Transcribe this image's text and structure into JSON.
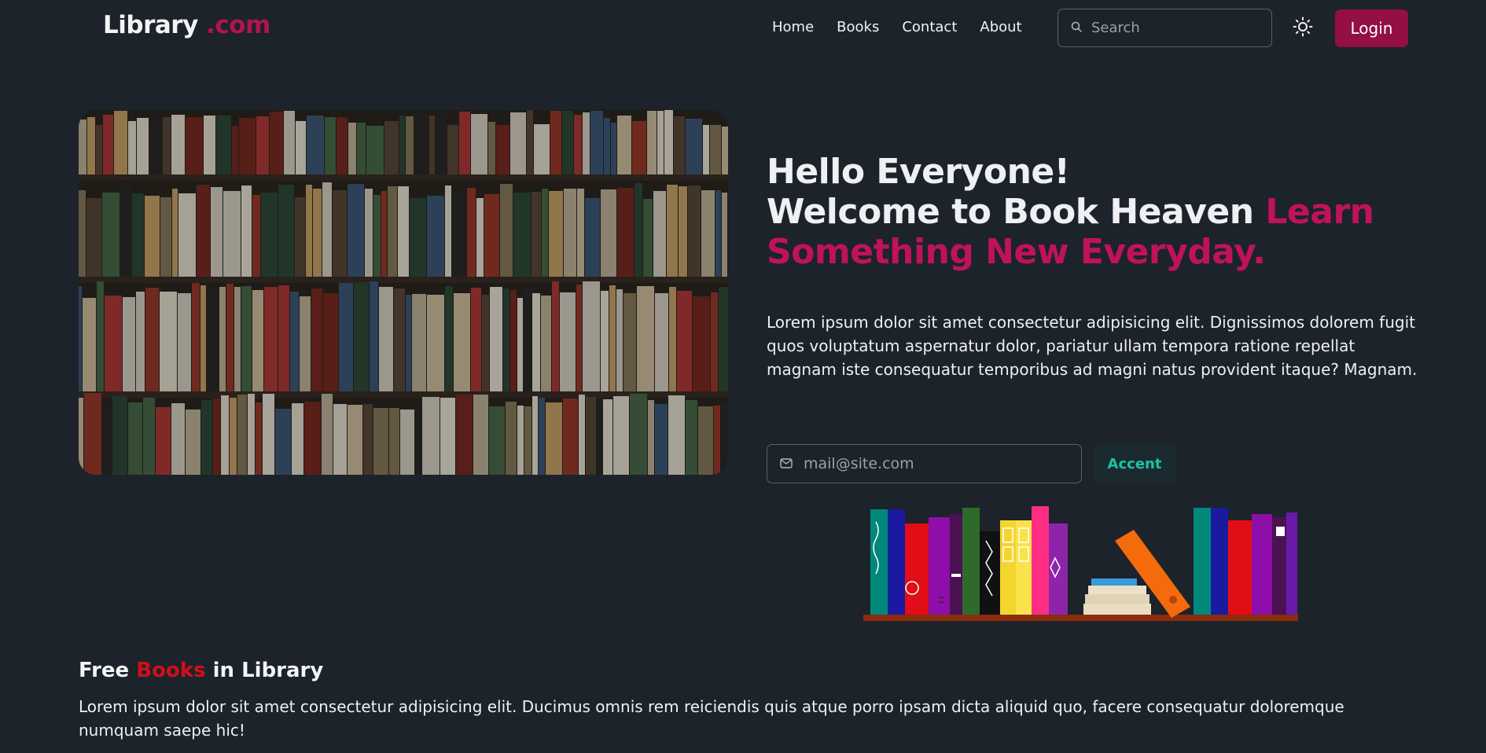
{
  "brand": {
    "name": "Library",
    "suffix": " .com"
  },
  "nav": {
    "links": [
      "Home",
      "Books",
      "Contact",
      "About"
    ],
    "search_placeholder": "Search",
    "theme_icon": "sun-icon",
    "login_label": "Login"
  },
  "hero": {
    "title_line1": "Hello Everyone!",
    "title_line2": "Welcome to Book Heaven ",
    "title_highlight": "Learn Something New Everyday.",
    "description": "Lorem ipsum dolor sit amet consectetur adipisicing elit. Dignissimos dolorem fugit quos voluptatum aspernatur dolor, pariatur ullam tempora ratione repellat magnam iste consequatur temporibus ad magni natus provident itaque? Magnam.",
    "email_placeholder": "mail@site.com",
    "accent_label": "Accent"
  },
  "section": {
    "title_prefix": "Free ",
    "title_highlight": "Books",
    "title_suffix": " in Library",
    "description": "Lorem ipsum dolor sit amet consectetur adipisicing elit. Ducimus omnis rem reiciendis quis atque porro ipsam dicta aliquid quo, facere consequatur doloremque numquam saepe hic!"
  },
  "colors": {
    "background": "#1d232a",
    "brand_accent": "#b0154e",
    "login_bg": "#930f46",
    "hero_highlight": "#c0125a",
    "accent_text": "#19c5a6",
    "section_highlight": "#d10f1a"
  }
}
